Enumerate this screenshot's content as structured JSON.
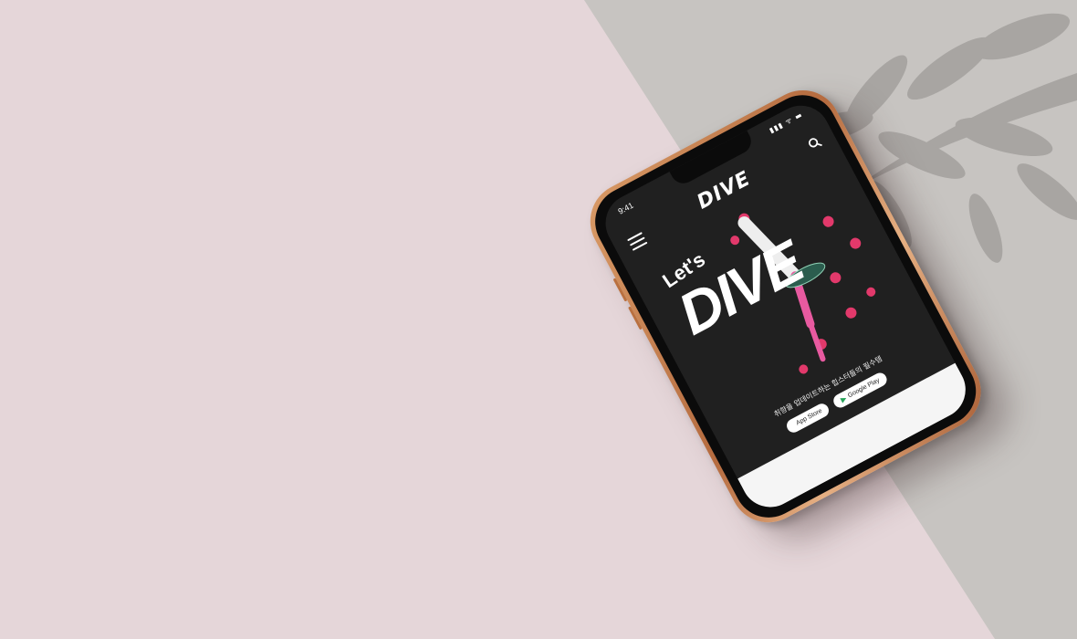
{
  "status_bar": {
    "time": "9:41",
    "icons": "▮▮▮ ᯤ ▬"
  },
  "header": {
    "logo": "DIVE"
  },
  "hero": {
    "lets": "Let's",
    "dive": "DIVE"
  },
  "tagline": "취향을 업데이트하는 힙스터들의 필수템",
  "store_buttons": [
    {
      "label": "App Store",
      "icon": "apple-icon"
    },
    {
      "label": "Google Play",
      "icon": "play-icon"
    }
  ],
  "colors": {
    "background_left": "#e5d6d9",
    "background_right": "#c9c6c3",
    "screen": "#202020",
    "flower": "#e2396b",
    "phone_frame": "#c27a4a"
  }
}
